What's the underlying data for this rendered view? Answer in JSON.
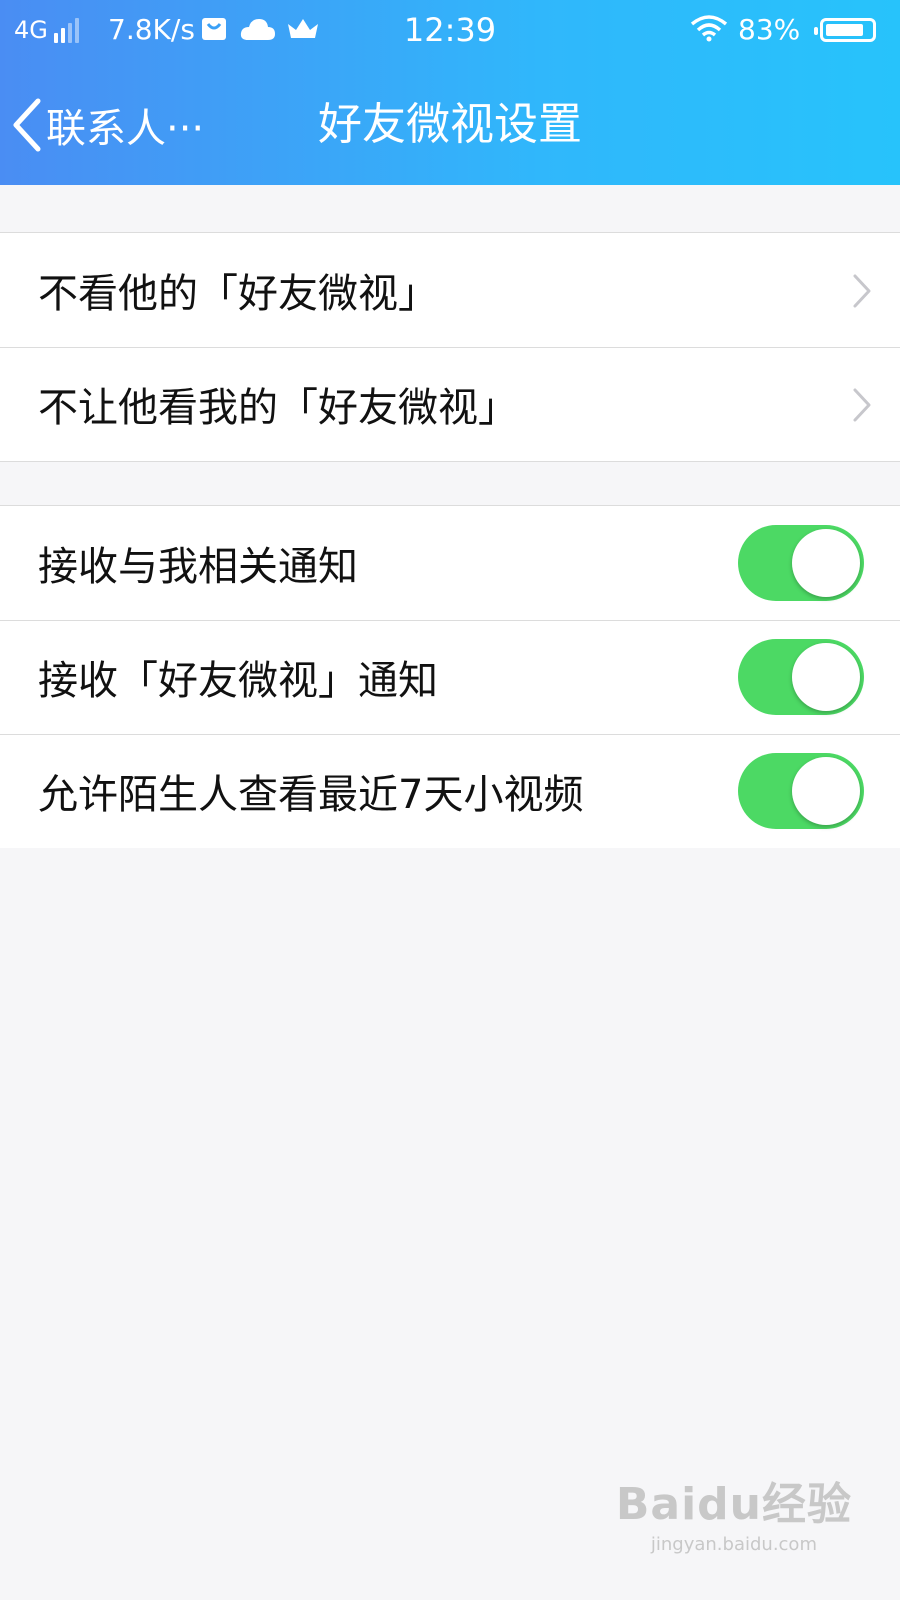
{
  "status_bar": {
    "network": "4G",
    "speed": "7.8K/s",
    "time": "12:39",
    "battery": "83%",
    "battery_level": 0.83,
    "icons": [
      "signal-icon",
      "bag-icon",
      "cloud-icon",
      "crown-icon",
      "wifi-icon",
      "battery-icon"
    ]
  },
  "nav": {
    "back_label": "联系人···",
    "title": "好友微视设置"
  },
  "group1": {
    "items": [
      {
        "label": "不看他的「好友微视」"
      },
      {
        "label": "不让他看我的「好友微视」"
      }
    ]
  },
  "group2": {
    "items": [
      {
        "label": "接收与我相关通知",
        "on": true
      },
      {
        "label": "接收「好友微视」通知",
        "on": true
      },
      {
        "label": "允许陌生人查看最近7天小视频",
        "on": true
      }
    ]
  },
  "watermark": {
    "logo": "Baidu经验",
    "url": "jingyan.baidu.com"
  },
  "colors": {
    "header_start": "#4a8df3",
    "header_end": "#27c3fb",
    "switch_on": "#4cd964",
    "background": "#f6f6f8"
  }
}
